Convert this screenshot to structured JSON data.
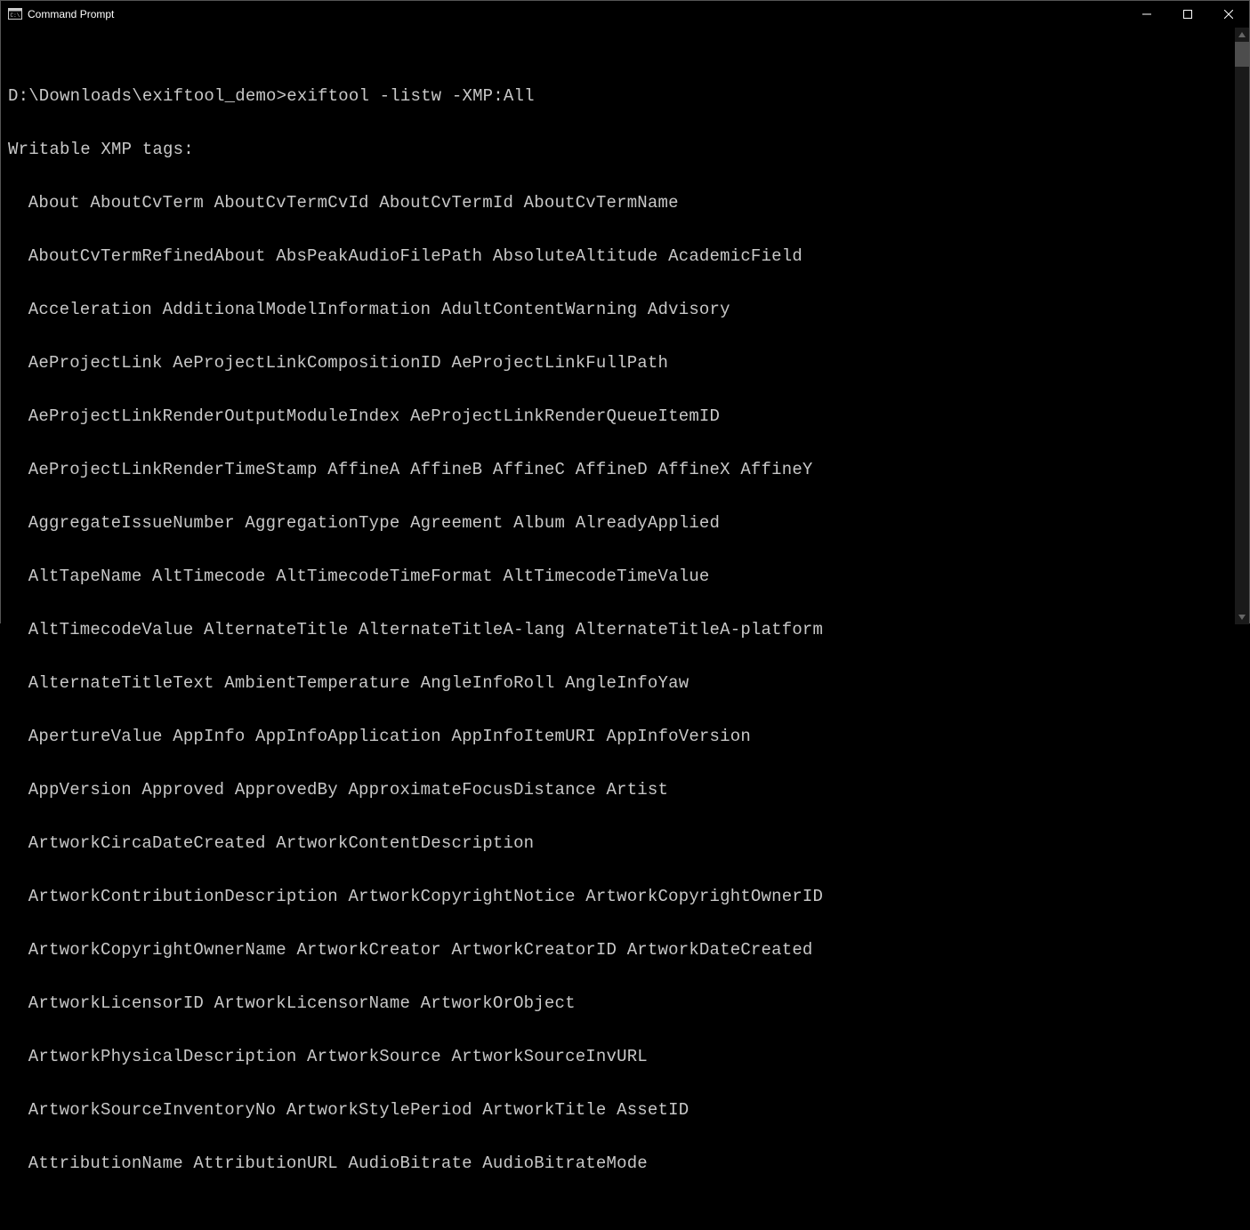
{
  "titlebar": {
    "title": "Command Prompt"
  },
  "terminal": {
    "prompt": "D:\\Downloads\\exiftool_demo>",
    "command": "exiftool -listw -XMP:All",
    "header": "Writable XMP tags:",
    "lines": [
      "About AboutCvTerm AboutCvTermCvId AboutCvTermId AboutCvTermName",
      "AboutCvTermRefinedAbout AbsPeakAudioFilePath AbsoluteAltitude AcademicField",
      "Acceleration AdditionalModelInformation AdultContentWarning Advisory",
      "AeProjectLink AeProjectLinkCompositionID AeProjectLinkFullPath",
      "AeProjectLinkRenderOutputModuleIndex AeProjectLinkRenderQueueItemID",
      "AeProjectLinkRenderTimeStamp AffineA AffineB AffineC AffineD AffineX AffineY",
      "AggregateIssueNumber AggregationType Agreement Album AlreadyApplied",
      "AltTapeName AltTimecode AltTimecodeTimeFormat AltTimecodeTimeValue",
      "AltTimecodeValue AlternateTitle AlternateTitleA-lang AlternateTitleA-platform",
      "AlternateTitleText AmbientTemperature AngleInfoRoll AngleInfoYaw",
      "ApertureValue AppInfo AppInfoApplication AppInfoItemURI AppInfoVersion",
      "AppVersion Approved ApprovedBy ApproximateFocusDistance Artist",
      "ArtworkCircaDateCreated ArtworkContentDescription",
      "ArtworkContributionDescription ArtworkCopyrightNotice ArtworkCopyrightOwnerID",
      "ArtworkCopyrightOwnerName ArtworkCreator ArtworkCreatorID ArtworkDateCreated",
      "ArtworkLicensorID ArtworkLicensorName ArtworkOrObject",
      "ArtworkPhysicalDescription ArtworkSource ArtworkSourceInvURL",
      "ArtworkSourceInventoryNo ArtworkStylePeriod ArtworkTitle AssetID",
      "AttributionName AttributionURL AudioBitrate AudioBitrateMode"
    ]
  }
}
